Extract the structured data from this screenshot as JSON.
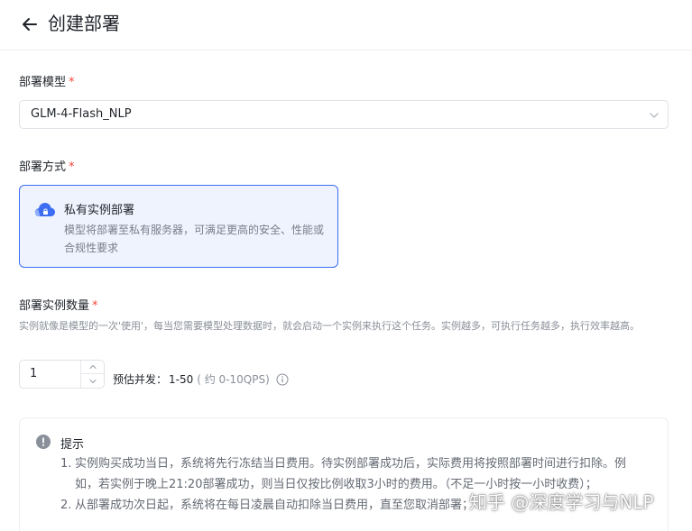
{
  "header": {
    "title": "创建部署",
    "back_icon": "arrow-left-icon"
  },
  "model": {
    "label": "部署模型",
    "required_mark": "*",
    "selected": "GLM-4-Flash_NLP"
  },
  "method": {
    "label": "部署方式",
    "required_mark": "*",
    "option": {
      "title": "私有实例部署",
      "description": "模型将部署至私有服务器，可满足更高的安全、性能或合规性要求",
      "icon": "cloud-icon",
      "selected": true
    }
  },
  "instances": {
    "label": "部署实例数量",
    "required_mark": "*",
    "hint": "实例就像是模型的一次'使用'，每当您需要模型处理数据时，就会启动一个实例来执行这个任务。实例越多，可执行任务越多，执行效率越高。",
    "value": "1",
    "estimate_label": "预估并发：",
    "estimate_value": "1-50",
    "estimate_note": "( 约 0-10QPS)"
  },
  "tip": {
    "title": "提示",
    "items": [
      {
        "num": "1.",
        "text": "实例购买成功当日，系统将先行冻结当日费用。待实例部署成功后，实际费用将按照部署时间进行扣除。例如，若实例于晚上21:20部署成功，则当日仅按比例收取3小时的费用。（不足一小时按一小时收费）；"
      },
      {
        "num": "2.",
        "text": "从部署成功次日起，系统将在每日凌晨自动扣除当日费用，直至您取消部署；"
      }
    ]
  },
  "watermark": "知乎 @深度学习与NLP",
  "colors": {
    "accent": "#3d6df2",
    "card_bg": "#eef3fe",
    "required": "#f5483b"
  }
}
